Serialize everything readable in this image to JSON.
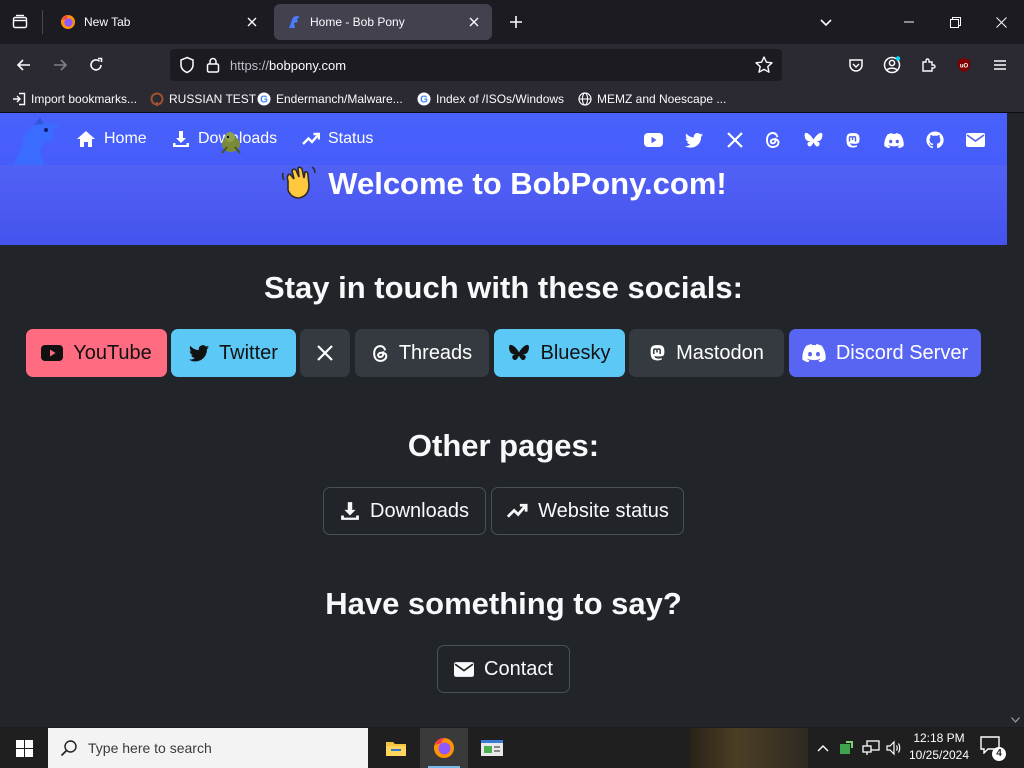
{
  "browser": {
    "tabs": [
      {
        "title": "New Tab",
        "active": false
      },
      {
        "title": "Home - Bob Pony",
        "active": true
      }
    ],
    "url": {
      "scheme": "https://",
      "host": "bobpony.com"
    },
    "bookmarks": [
      {
        "label": "Import bookmarks...",
        "icon": "import-icon"
      },
      {
        "label": "RUSSIAN TEST",
        "icon": "russian-test-favicon"
      },
      {
        "label": "Endermanch/Malware...",
        "icon": "google-favicon"
      },
      {
        "label": "Index of /ISOs/Windows",
        "icon": "google-favicon"
      },
      {
        "label": "MEMZ and Noescape ...",
        "icon": "globe-icon"
      }
    ]
  },
  "site": {
    "nav": {
      "home": "Home",
      "downloads": "Downloads",
      "status": "Status"
    },
    "social_icons": [
      "youtube-icon",
      "twitter-icon",
      "x-icon",
      "threads-icon",
      "bluesky-icon",
      "mastodon-icon",
      "discord-icon",
      "github-icon",
      "mail-icon"
    ],
    "welcome": "Welcome to BobPony.com!",
    "socials_heading": "Stay in touch with these socials:",
    "socials": [
      {
        "label": "YouTube",
        "color": "#ff6b81",
        "text_color": "#111111",
        "icon": "youtube-icon"
      },
      {
        "label": "Twitter",
        "color": "#5cc8f5",
        "text_color": "#111111",
        "icon": "twitter-icon"
      },
      {
        "label": "",
        "color": "#343a40",
        "text_color": "#ffffff",
        "icon": "x-icon"
      },
      {
        "label": "Threads",
        "color": "#343a40",
        "text_color": "#ffffff",
        "icon": "threads-icon"
      },
      {
        "label": "Bluesky",
        "color": "#5cc8f5",
        "text_color": "#111111",
        "icon": "bluesky-icon"
      },
      {
        "label": "Mastodon",
        "color": "#343a40",
        "text_color": "#ffffff",
        "icon": "mastodon-icon"
      },
      {
        "label": "Discord Server",
        "color": "#5865f2",
        "text_color": "#ffffff",
        "icon": "discord-icon"
      }
    ],
    "other_heading": "Other pages:",
    "other_pages": [
      {
        "label": "Downloads",
        "icon": "download-icon"
      },
      {
        "label": "Website status",
        "icon": "trending-up-icon"
      }
    ],
    "say_heading": "Have something to say?",
    "contact": "Contact"
  },
  "taskbar": {
    "search_placeholder": "Type here to search",
    "time": "12:18 PM",
    "date": "10/25/2024",
    "notifications": "4"
  }
}
